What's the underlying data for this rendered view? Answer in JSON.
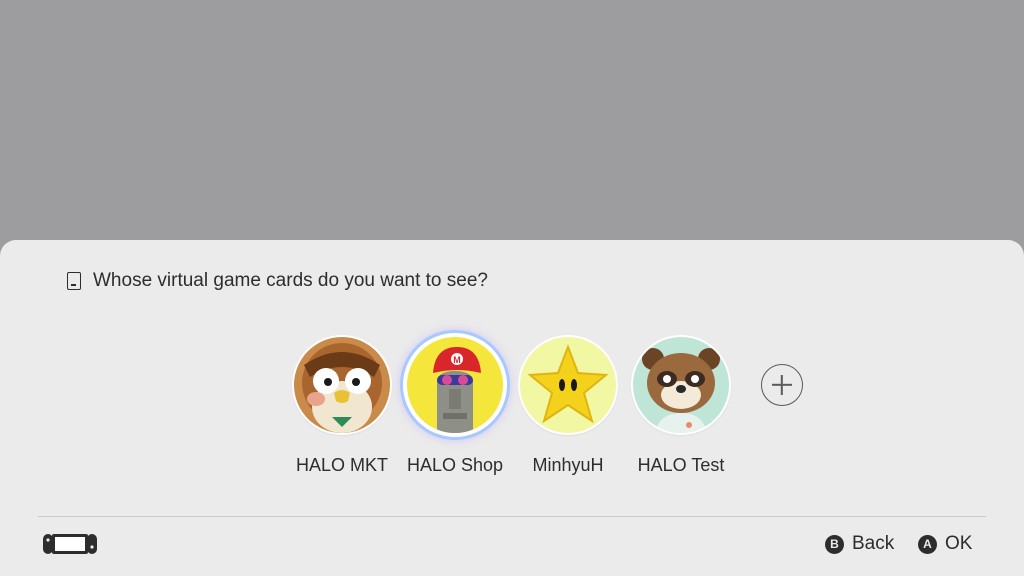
{
  "prompt": {
    "icon": "game-card-icon",
    "text": "Whose virtual game cards do you want to see?"
  },
  "users": [
    {
      "name": "HALO MKT",
      "avatar": "owl-character-avatar",
      "selected": false
    },
    {
      "name": "HALO Shop",
      "avatar": "statue-with-red-cap-avatar",
      "selected": true
    },
    {
      "name": "MinhyuH",
      "avatar": "yellow-star-avatar",
      "selected": false
    },
    {
      "name": "HALO Test",
      "avatar": "raccoon-character-avatar",
      "selected": false
    }
  ],
  "add_user": {
    "icon": "plus-icon"
  },
  "footer": {
    "console_icon": "switch-console-icon",
    "back": {
      "glyph": "B",
      "label": "Back"
    },
    "ok": {
      "glyph": "A",
      "label": "OK"
    }
  }
}
